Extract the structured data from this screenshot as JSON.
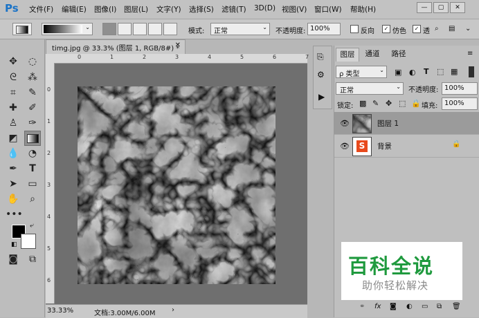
{
  "app": {
    "logo": "Ps"
  },
  "menu": [
    "文件(F)",
    "编辑(E)",
    "图像(I)",
    "图层(L)",
    "文字(Y)",
    "选择(S)",
    "滤镜(T)",
    "3D(D)",
    "视图(V)",
    "窗口(W)",
    "帮助(H)"
  ],
  "window_controls": [
    "—",
    "▢",
    "✕"
  ],
  "options": {
    "mode_label": "模式:",
    "mode_value": "正常",
    "opacity_label": "不透明度:",
    "opacity_value": "100%",
    "reverse_label": "反向",
    "dither_label": "仿色",
    "transparency_label": "透"
  },
  "document": {
    "tab_title": "timg.jpg @ 33.3% (图层 1, RGB/8#) *",
    "ruler_top": [
      "0",
      "1",
      "2",
      "3",
      "4",
      "5",
      "6",
      "7"
    ],
    "ruler_left": [
      "0",
      "1",
      "2",
      "3",
      "4",
      "5",
      "6",
      "7"
    ],
    "zoom": "33.33%",
    "doc_info": "文档:3.00M/6.00M"
  },
  "layers_panel": {
    "tabs": [
      "图层",
      "通道",
      "路径"
    ],
    "filter_label": "ρ 类型",
    "blend_mode": "正常",
    "opacity_label": "不透明度:",
    "opacity_value": "100%",
    "lock_label": "锁定:",
    "fill_label": "填充:",
    "fill_value": "100%",
    "layers": [
      {
        "name": "图层 1",
        "selected": true
      },
      {
        "name": "背景",
        "locked": true
      }
    ],
    "bottom_icons": [
      "link-icon",
      "fx-icon",
      "mask-icon",
      "adjustment-icon",
      "folder-icon",
      "new-layer-icon",
      "trash-icon"
    ],
    "bottom_fx_label": "fx"
  },
  "watermark": {
    "title": "百科全说",
    "subtitle": "助你轻松解决"
  },
  "colors": {
    "watermark_green": "#1f9a3e",
    "watermark_gray": "#8a8a8a",
    "logo_blue": "#1a73c7"
  }
}
